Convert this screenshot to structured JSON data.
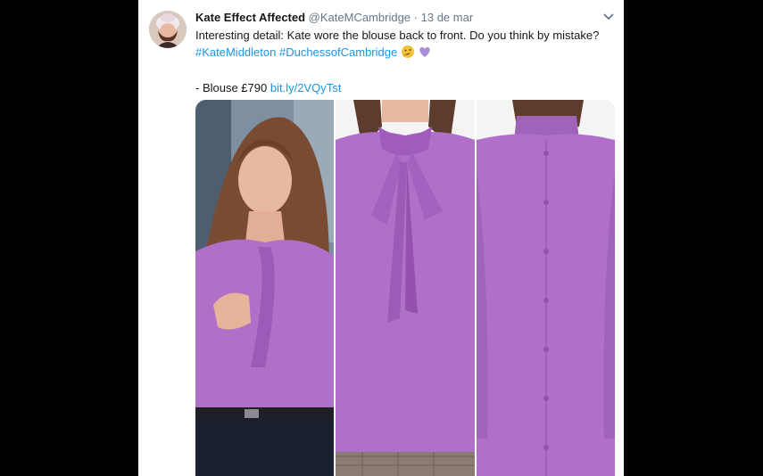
{
  "tweet": {
    "display_name": "Kate Effect Affected",
    "handle": "@KateMCambridge",
    "separator": "·",
    "date": "13 de mar",
    "text": "Interesting detail: Kate wore the blouse back to front. Do you think by mistake?",
    "hashtags": [
      "#KateMiddleton",
      "#DuchessofCambridge"
    ],
    "emoji": [
      "thinking-face-icon",
      "purple-heart-icon"
    ],
    "price_prefix": "- Blouse £790",
    "link": "bit.ly/2VQyTst"
  },
  "colors": {
    "link": "#1b95e0",
    "blouse": "#b06fc8",
    "muted": "#657786",
    "text": "#14171a"
  }
}
